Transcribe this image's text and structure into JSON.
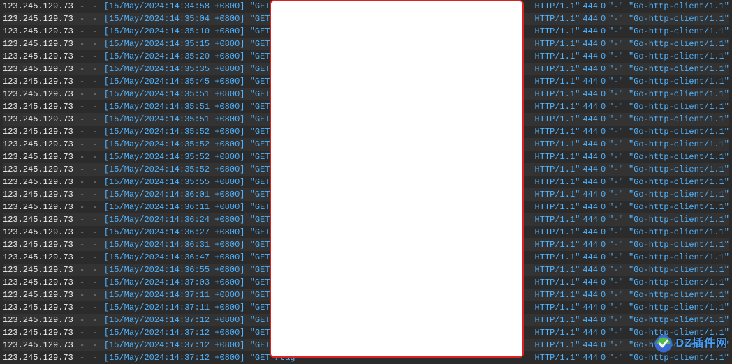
{
  "log": {
    "ip": "123.245.129.73",
    "ident": "-",
    "user": "-",
    "method": "GET",
    "path_prefix": "/tag",
    "protocol": "HTTP/1.1",
    "status": "444",
    "size": "0",
    "referer": "-",
    "user_agent": "Go-http-client/1.1",
    "rows": [
      {
        "timestamp": "15/May/2024:14:34:58 +0800"
      },
      {
        "timestamp": "15/May/2024:14:35:04 +0800"
      },
      {
        "timestamp": "15/May/2024:14:35:10 +0800"
      },
      {
        "timestamp": "15/May/2024:14:35:15 +0800"
      },
      {
        "timestamp": "15/May/2024:14:35:20 +0800"
      },
      {
        "timestamp": "15/May/2024:14:35:35 +0800"
      },
      {
        "timestamp": "15/May/2024:14:35:45 +0800"
      },
      {
        "timestamp": "15/May/2024:14:35:51 +0800"
      },
      {
        "timestamp": "15/May/2024:14:35:51 +0800"
      },
      {
        "timestamp": "15/May/2024:14:35:51 +0800"
      },
      {
        "timestamp": "15/May/2024:14:35:52 +0800"
      },
      {
        "timestamp": "15/May/2024:14:35:52 +0800"
      },
      {
        "timestamp": "15/May/2024:14:35:52 +0800"
      },
      {
        "timestamp": "15/May/2024:14:35:52 +0800"
      },
      {
        "timestamp": "15/May/2024:14:35:55 +0800"
      },
      {
        "timestamp": "15/May/2024:14:36:01 +0800"
      },
      {
        "timestamp": "15/May/2024:14:36:11 +0800"
      },
      {
        "timestamp": "15/May/2024:14:36:24 +0800"
      },
      {
        "timestamp": "15/May/2024:14:36:27 +0800"
      },
      {
        "timestamp": "15/May/2024:14:36:31 +0800"
      },
      {
        "timestamp": "15/May/2024:14:36:47 +0800"
      },
      {
        "timestamp": "15/May/2024:14:36:55 +0800"
      },
      {
        "timestamp": "15/May/2024:14:37:03 +0800"
      },
      {
        "timestamp": "15/May/2024:14:37:11 +0800"
      },
      {
        "timestamp": "15/May/2024:14:37:11 +0800"
      },
      {
        "timestamp": "15/May/2024:14:37:12 +0800"
      },
      {
        "timestamp": "15/May/2024:14:37:12 +0800"
      },
      {
        "timestamp": "15/May/2024:14:37:12 +0800"
      },
      {
        "timestamp": "15/May/2024:14:37:12 +0800"
      }
    ]
  },
  "watermark": {
    "text": "DZ插件网"
  }
}
